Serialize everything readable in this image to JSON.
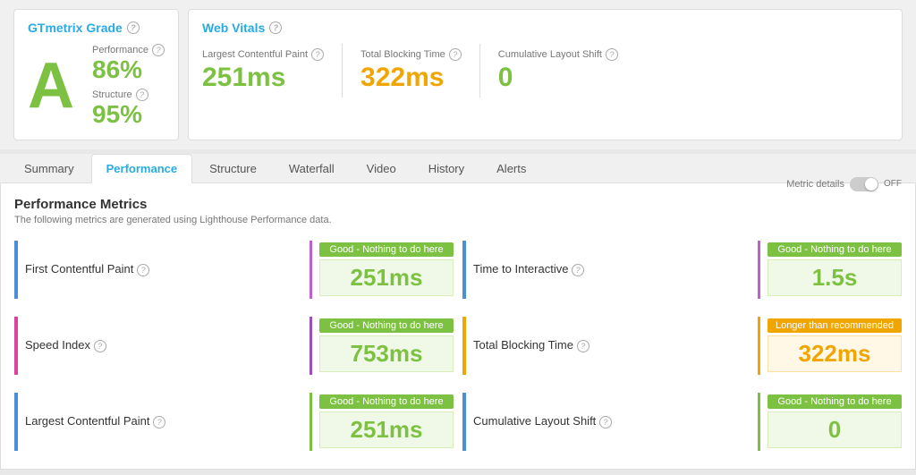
{
  "header": {
    "grade_title": "GTmetrix Grade",
    "grade_letter": "A",
    "performance_label": "Performance",
    "performance_value": "86%",
    "structure_label": "Structure",
    "structure_value": "95%",
    "web_vitals_title": "Web Vitals",
    "lcp_label": "Largest Contentful Paint",
    "lcp_value": "251ms",
    "tbt_label": "Total Blocking Time",
    "tbt_value": "322ms",
    "cls_label": "Cumulative Layout Shift",
    "cls_value": "0"
  },
  "tabs": [
    {
      "label": "Summary",
      "active": false
    },
    {
      "label": "Performance",
      "active": true
    },
    {
      "label": "Structure",
      "active": false
    },
    {
      "label": "Waterfall",
      "active": false
    },
    {
      "label": "Video",
      "active": false
    },
    {
      "label": "History",
      "active": false
    },
    {
      "label": "Alerts",
      "active": false
    }
  ],
  "performance": {
    "title": "Performance Metrics",
    "subtitle": "The following metrics are generated using Lighthouse Performance data.",
    "metric_details_label": "Metric details",
    "toggle_label": "OFF",
    "metrics": [
      {
        "label": "First Contentful Paint",
        "badge": "Good - Nothing to do here",
        "badge_type": "green",
        "value": "251ms",
        "value_type": "green",
        "border": "blue"
      },
      {
        "label": "Time to Interactive",
        "badge": "Good - Nothing to do here",
        "badge_type": "green",
        "value": "1.5s",
        "value_type": "green",
        "border": "blue"
      },
      {
        "label": "Speed Index",
        "badge": "Good - Nothing to do here",
        "badge_type": "green",
        "value": "753ms",
        "value_type": "green",
        "border": "pink"
      },
      {
        "label": "Total Blocking Time",
        "badge": "Longer than recommended",
        "badge_type": "orange",
        "value": "322ms",
        "value_type": "orange",
        "border": "orange"
      },
      {
        "label": "Largest Contentful Paint",
        "badge": "Good - Nothing to do here",
        "badge_type": "green",
        "value": "251ms",
        "value_type": "green",
        "border": "blue"
      },
      {
        "label": "Cumulative Layout Shift",
        "badge": "Good - Nothing to do here",
        "badge_type": "green",
        "value": "0",
        "value_type": "green",
        "border": "blue"
      }
    ]
  }
}
